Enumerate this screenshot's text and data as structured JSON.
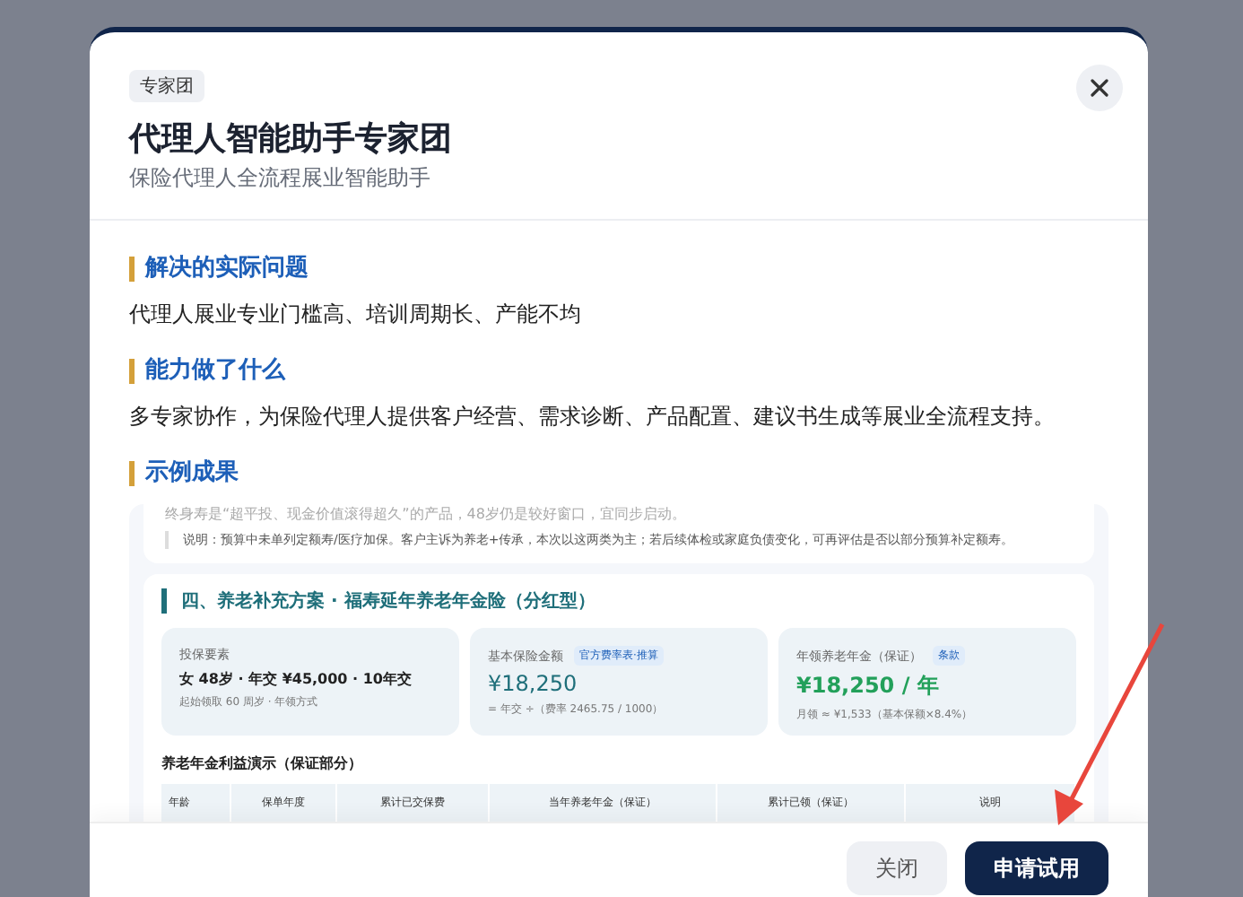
{
  "dialog": {
    "tag": "专家团",
    "title": "代理人智能助手专家团",
    "subtitle": "保险代理人全流程展业智能助手"
  },
  "sections": [
    {
      "heading": "解决的实际问题",
      "text": "代理人展业专业门槛高、培训周期长、产能不均"
    },
    {
      "heading": "能力做了什么",
      "text": "多专家协作，为保险代理人提供客户经营、需求诊断、产品配置、建议书生成等展业全流程支持。"
    }
  ],
  "example": {
    "heading": "示例成果",
    "preview": {
      "faded_line": "终身寿是“超平投、现金价值滚得超久”的产品，48岁仍是较好窗口，宜同步启动。",
      "note": "说明：预算中未单列定额寿/医疗加保。客户主诉为养老+传承，本次以这两类为主；若后续体检或家庭负债变化，可再评估是否以部分预算补定额寿。",
      "plan_title": "四、养老补充方案 · 福寿延年养老年金险（分红型）",
      "cards": [
        {
          "label": "投保要素",
          "value": "女 48岁 · 年交 ¥45,000 · 10年交",
          "kind": "plain",
          "note": "起始领取 60 周岁 · 年领方式"
        },
        {
          "label": "基本保险金额",
          "badge": "官方费率表·推算",
          "value": "¥18,250",
          "kind": "amount",
          "note": "= 年交 ÷（费率 2465.75 / 1000）"
        },
        {
          "label": "年领养老年金（保证）",
          "badge": "条款",
          "value": "¥18,250 / 年",
          "kind": "annuity",
          "note": "月领 ≈ ¥1,533（基本保额×8.4%）"
        }
      ],
      "table_title": "养老年金利益演示（保证部分）",
      "columns": [
        "年龄",
        "保单年度",
        "累计已交保费",
        "当年养老年金（保证）",
        "累计已领（保证）",
        "说明"
      ]
    }
  },
  "buttons": [
    {
      "label": "关闭",
      "kind": "secondary"
    },
    {
      "label": "申请试用",
      "kind": "primary"
    }
  ]
}
